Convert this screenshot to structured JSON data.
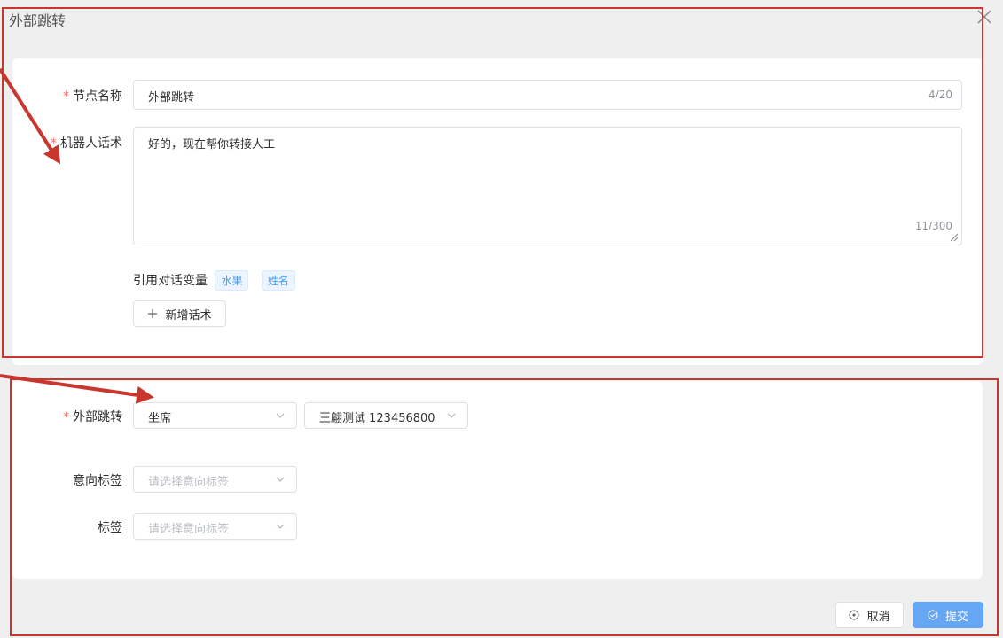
{
  "dialog": {
    "title": "外部跳转"
  },
  "node_name": {
    "label": "节点名称",
    "value": "外部跳转",
    "counter": "4/20"
  },
  "robot_script": {
    "label": "机器人话术",
    "value": "好的，现在帮你转接人工",
    "counter": "11/300"
  },
  "variables": {
    "label": "引用对话变量",
    "tags": [
      "水果",
      "姓名"
    ]
  },
  "add_script_button": {
    "label": "新增话术"
  },
  "external_jump": {
    "label": "外部跳转",
    "type_value": "坐席",
    "target_value": "王翩测试 123456800"
  },
  "intent_tag": {
    "label": "意向标签",
    "placeholder": "请选择意向标签"
  },
  "tag": {
    "label": "标签",
    "placeholder": "请选择意向标签"
  },
  "footer": {
    "cancel_label": "取消",
    "submit_label": "提交"
  },
  "colors": {
    "accent": "#66a7f5",
    "required": "#f56c6c",
    "annotation": "#c8372d"
  }
}
